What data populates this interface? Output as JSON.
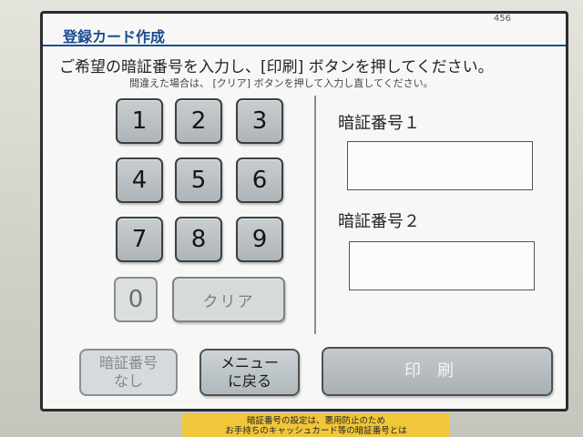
{
  "header": {
    "title": "登録カード作成",
    "screen_id": "456"
  },
  "instruction": "ご希望の暗証番号を入力し、[印刷] ボタンを押してください。",
  "subnote": "間違えた場合は、 [クリア] ボタンを押して入力し直してください。",
  "keypad": {
    "keys": [
      "1",
      "2",
      "3",
      "4",
      "5",
      "6",
      "7",
      "8",
      "9"
    ],
    "zero": "0",
    "clear": "クリア"
  },
  "fields": {
    "pin1_label": "暗証番号１",
    "pin1_value": "",
    "pin2_label": "暗証番号２",
    "pin2_value": ""
  },
  "buttons": {
    "no_pin": "暗証番号\nなし",
    "menu": "メニュー\nに戻る",
    "print": "印刷"
  },
  "sticker": {
    "line1": "暗証番号の設定は、悪用防止のため",
    "line2": "お手持ちのキャッシュカード等の暗証番号とは"
  }
}
